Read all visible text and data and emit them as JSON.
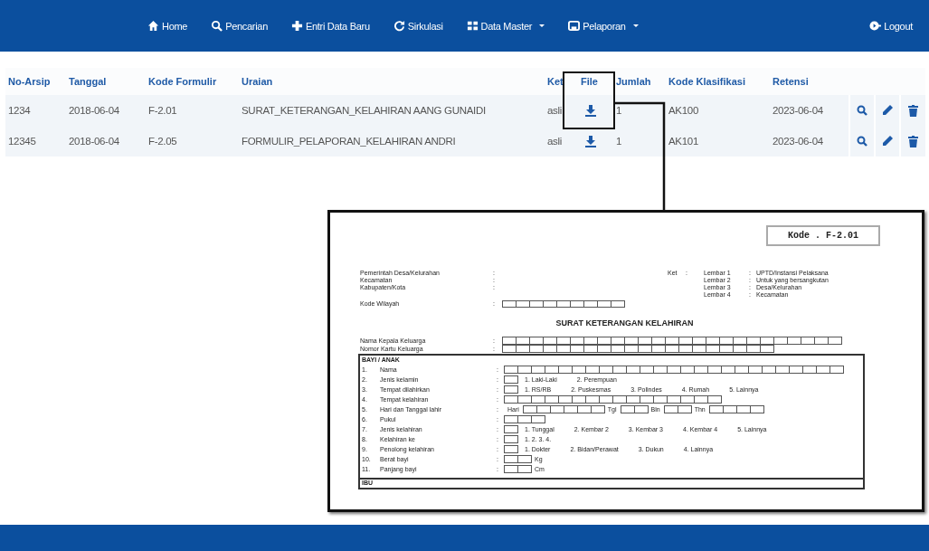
{
  "nav": {
    "items": [
      {
        "label": "Home",
        "dropdown": false
      },
      {
        "label": "Pencarian",
        "dropdown": false
      },
      {
        "label": "Entri Data Baru",
        "dropdown": false
      },
      {
        "label": "Sirkulasi",
        "dropdown": false
      },
      {
        "label": "Data Master",
        "dropdown": true
      },
      {
        "label": "Pelaporan",
        "dropdown": true
      }
    ],
    "logout": {
      "label": "Logout"
    }
  },
  "table": {
    "columns": [
      "No-Arsip",
      "Tanggal",
      "Kode Formulir",
      "Uraian",
      "Ket",
      "File",
      "Jumlah",
      "Kode Klasifikasi",
      "Retensi"
    ],
    "rows": [
      {
        "no_arsip": "1234",
        "tanggal": "2018-06-04",
        "kode_formulir": "F-2.01",
        "uraian": "SURAT_KETERANGAN_KELAHIRAN AANG GUNAIDI",
        "ket": "asli",
        "jumlah": "1",
        "kode_klasifikasi": "AK100",
        "retensi": "2023-06-04"
      },
      {
        "no_arsip": "12345",
        "tanggal": "2018-06-04",
        "kode_formulir": "F-2.05",
        "uraian": "FORMULIR_PELAPORAN_KELAHIRAN ANDRI",
        "ket": "asli",
        "jumlah": "1",
        "kode_klasifikasi": "AK101",
        "retensi": "2023-06-04"
      }
    ]
  },
  "preview": {
    "code": "Kode . F-2.01",
    "header": [
      {
        "label": "Pemerintah Desa/Kelurahan",
        "sep": ":"
      },
      {
        "label": "Kecamatan",
        "sep": ":"
      },
      {
        "label": "Kabupaten/Kota",
        "sep": ":"
      }
    ],
    "ket": {
      "label": "Ket",
      "sep": ":",
      "sheets": [
        {
          "label": "Lembar 1",
          "sep": ":",
          "value": "UPTD/Instansi Pelaksana"
        },
        {
          "label": "Lembar 2",
          "sep": ":",
          "value": "Untuk yang bersangkutan"
        },
        {
          "label": "Lembar 3",
          "sep": ":",
          "value": "Desa/Kelurahan"
        },
        {
          "label": "Lembar 4",
          "sep": ":",
          "value": "Kecamatan"
        }
      ]
    },
    "region": {
      "label": "Kode Wilayah",
      "sep": ":"
    },
    "title": "SURAT KETERANGAN KELAHIRAN",
    "family": [
      {
        "label": "Nama Kepala Keluarga",
        "sep": ":",
        "kind": "long"
      },
      {
        "label": "Nomor Kartu Keluarga",
        "sep": ":",
        "kind": "short"
      }
    ],
    "section": "BAYI / ANAK",
    "items": [
      {
        "no": "1.",
        "label": "Nama",
        "sep": ":",
        "kind": "boxes"
      },
      {
        "no": "2.",
        "label": "Jenis kelamin",
        "sep": ":",
        "kind": "choice",
        "options": [
          "1. Laki-Laki",
          "2. Perempuan"
        ]
      },
      {
        "no": "3.",
        "label": "Tempat dilahirkan",
        "sep": ":",
        "kind": "choice",
        "options": [
          "1. RS/RB",
          "2. Puskesmas",
          "3. Polindes",
          "4. Rumah",
          "5. Lainnya"
        ]
      },
      {
        "no": "4.",
        "label": "Tempat kelahiran",
        "sep": ":",
        "kind": "place"
      },
      {
        "no": "5.",
        "label": "Hari dan Tanggal lahir",
        "sep": ":",
        "kind": "date",
        "parts": [
          "Hari",
          "Tgl",
          "Bln",
          "Thn"
        ]
      },
      {
        "no": "6.",
        "label": "Pukul",
        "sep": ":",
        "kind": "time"
      },
      {
        "no": "7.",
        "label": "Jenis kelahiran",
        "sep": ":",
        "kind": "choice",
        "options": [
          "1. Tunggal",
          "2. Kembar 2",
          "3. Kembar 3",
          "4. Kembar 4",
          "5. Lainnya"
        ]
      },
      {
        "no": "8.",
        "label": "Kelahiran ke",
        "sep": ":",
        "kind": "choice",
        "options": [
          "1. 2. 3. 4."
        ]
      },
      {
        "no": "9.",
        "label": "Penolong kelahiran",
        "sep": ":",
        "kind": "choice",
        "options": [
          "1. Dokter",
          "2. Bidan/Perawat",
          "3. Dukun",
          "4. Lainnya"
        ]
      },
      {
        "no": "10.",
        "label": "Berat bayi",
        "sep": ":",
        "kind": "measure",
        "unit": "Kg"
      },
      {
        "no": "11.",
        "label": "Panjang bayi",
        "sep": ":",
        "kind": "measure",
        "unit": "Cm"
      }
    ],
    "next_section": "IBU"
  }
}
